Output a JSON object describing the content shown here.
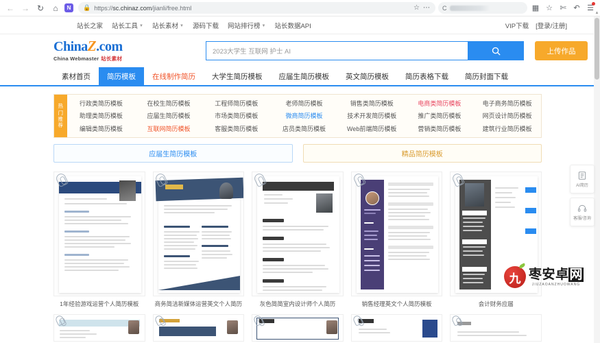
{
  "browser": {
    "url_protocol": "https://",
    "url_domain": "sc.chinaz.com",
    "url_path": "/jianli/free.html",
    "back_icon": "back-arrow-icon",
    "forward_icon": "forward-arrow-icon",
    "reload_icon": "reload-icon",
    "home_icon": "home-icon",
    "extension_icon": "extension-icon",
    "lock_icon": "secure-lock-icon",
    "bookmark_icon": "star-icon",
    "more_icon": "more-options-icon",
    "search_engine_icon": "search-engine-icon",
    "apps_icon": "apps-grid-icon",
    "collections_icon": "collections-icon",
    "cut_icon": "scissors-icon",
    "history_icon": "undo-icon",
    "menu_icon": "hamburger-menu-icon"
  },
  "topnav": {
    "items": [
      {
        "label": "站长之家",
        "caret": false
      },
      {
        "label": "站长工具",
        "caret": true
      },
      {
        "label": "站长素材",
        "caret": true
      },
      {
        "label": "源码下载",
        "caret": false
      },
      {
        "label": "网站排行榜",
        "caret": true
      },
      {
        "label": "站长数据API",
        "caret": false
      }
    ],
    "vip": "VIP下载",
    "account": "[登录/注册]"
  },
  "header": {
    "logo_main": "China",
    "logo_z": "Z",
    "logo_com": ".com",
    "logo_sub_en": "China Webmaster",
    "logo_sub_cn": "站长素材",
    "search_placeholder": "2023大学生 互联网 护士 AI",
    "search_value": "",
    "search_icon": "search-icon",
    "upload_label": "上传作品"
  },
  "cat_tabs": [
    {
      "label": "素材首页",
      "state": "normal"
    },
    {
      "label": "简历模板",
      "state": "active"
    },
    {
      "label": "在线制作简历",
      "state": "hot"
    },
    {
      "label": "大学生简历模板",
      "state": "normal"
    },
    {
      "label": "应届生简历模板",
      "state": "normal"
    },
    {
      "label": "英文简历模板",
      "state": "normal"
    },
    {
      "label": "简历表格下载",
      "state": "normal"
    },
    {
      "label": "简历封面下载",
      "state": "normal"
    }
  ],
  "hot_panel": {
    "tab_label": "热门推荐",
    "items": [
      {
        "label": "行政类简历模板",
        "hl": ""
      },
      {
        "label": "助理类简历模板",
        "hl": ""
      },
      {
        "label": "编辑类简历模板",
        "hl": ""
      },
      {
        "label": "在校生简历模板",
        "hl": ""
      },
      {
        "label": "应届生简历模板",
        "hl": ""
      },
      {
        "label": "互联网简历模板",
        "hl": "orange"
      },
      {
        "label": "工程师简历模板",
        "hl": ""
      },
      {
        "label": "市场类简历模板",
        "hl": ""
      },
      {
        "label": "客服类简历模板",
        "hl": ""
      },
      {
        "label": "老师简历模板",
        "hl": ""
      },
      {
        "label": "微商简历模板",
        "hl": "blue"
      },
      {
        "label": "店员类简历模板",
        "hl": ""
      },
      {
        "label": "销售类简历模板",
        "hl": ""
      },
      {
        "label": "技术开发简历模板",
        "hl": ""
      },
      {
        "label": "Web前端简历模板",
        "hl": ""
      },
      {
        "label": "电商类简历模板",
        "hl": "red"
      },
      {
        "label": "推广类简历模板",
        "hl": ""
      },
      {
        "label": "营销类简历模板",
        "hl": ""
      },
      {
        "label": "电子商务简历模板",
        "hl": ""
      },
      {
        "label": "网页设计简历模板",
        "hl": ""
      },
      {
        "label": "建筑行业简历模板",
        "hl": ""
      }
    ]
  },
  "promos": [
    {
      "label": "应届生简历模板",
      "style": "blue"
    },
    {
      "label": "精品简历模板",
      "style": "gold"
    }
  ],
  "thumbnails": [
    {
      "caption": "1年经验游戏运营个人简历模板",
      "design": "d1"
    },
    {
      "caption": "商务简洁新媒体运营英文个人简历",
      "design": "d2"
    },
    {
      "caption": "灰色简简室内设计师个人简历",
      "design": "d3"
    },
    {
      "caption": "销售经理英文个人简历模板",
      "design": "d4"
    },
    {
      "caption": "会计财务应届",
      "design": "d5"
    }
  ],
  "row2": [
    {
      "design": "r2a"
    },
    {
      "design": "r2b"
    },
    {
      "design": "r2c"
    },
    {
      "design": "r2d"
    },
    {
      "design": "r2e"
    }
  ],
  "side_widgets": [
    {
      "label": "AI简历",
      "icon": "ai-resume-icon"
    },
    {
      "label": "客服/咨询",
      "icon": "customer-service-icon"
    }
  ],
  "watermark": {
    "badge_char": "九",
    "text_1": "枣安卓",
    "text_2": "网",
    "subtitle": "JIUZAOANZHUOWANG"
  },
  "colors": {
    "brand_blue": "#2a8cf0",
    "accent_orange": "#f7a92b",
    "hot_orange": "#f0542a",
    "logo_blue": "#1a6fd4",
    "logo_orange": "#f7941e"
  }
}
